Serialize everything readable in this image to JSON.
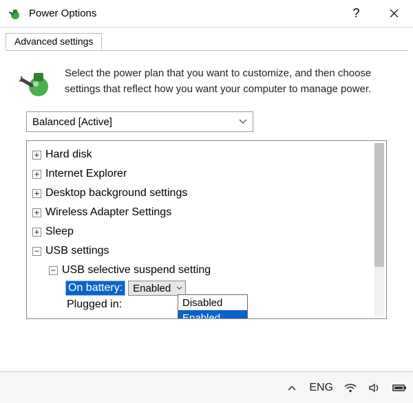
{
  "window": {
    "title": "Power Options",
    "help_symbol": "?",
    "close_symbol": "✕"
  },
  "tab": {
    "label": "Advanced settings"
  },
  "intro": {
    "text": "Select the power plan that you want to customize, and then choose settings that reflect how you want your computer to manage power."
  },
  "plan_dropdown": {
    "selected": "Balanced [Active]"
  },
  "tree": {
    "items": [
      {
        "label": "Hard disk"
      },
      {
        "label": "Internet Explorer"
      },
      {
        "label": "Desktop background settings"
      },
      {
        "label": "Wireless Adapter Settings"
      },
      {
        "label": "Sleep"
      }
    ],
    "usb": {
      "group_label": "USB settings",
      "subgroup_label": "USB selective suspend setting",
      "on_battery_label": "On battery:",
      "on_battery_value": "Enabled",
      "plugged_in_label": "Plugged in:"
    }
  },
  "dropdown_popup": {
    "options": [
      "Disabled",
      "Enabled"
    ],
    "selected_index": 1
  },
  "taskbar": {
    "lang": "ENG"
  },
  "glyphs": {
    "plus": "+",
    "minus": "−",
    "chev_down": "⌄",
    "chev_up": "˄"
  }
}
